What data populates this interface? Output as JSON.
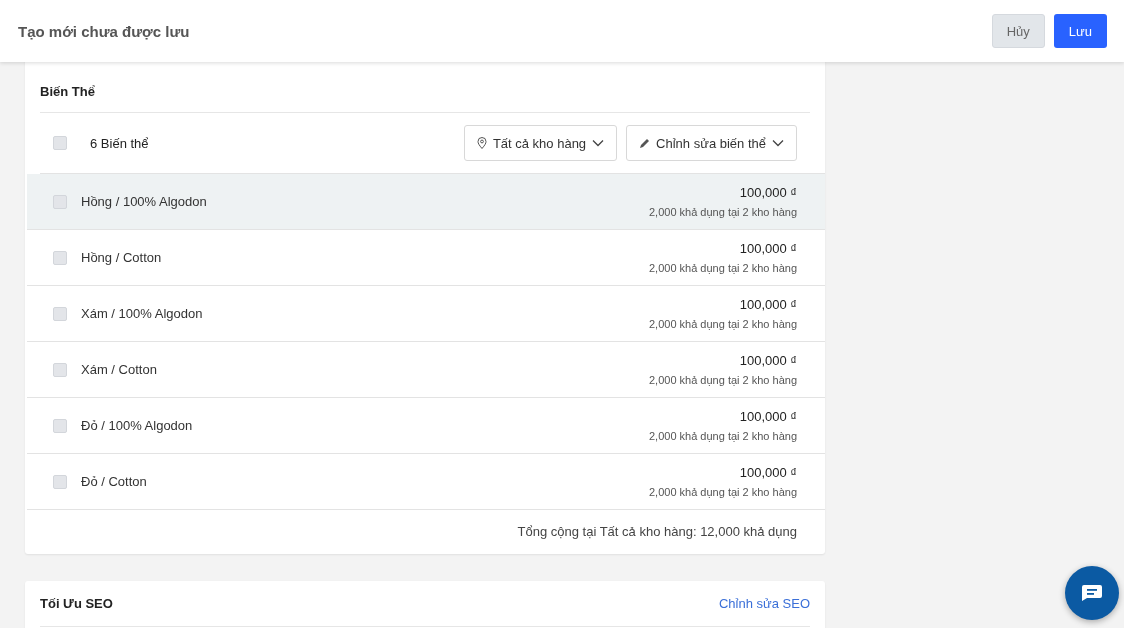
{
  "header": {
    "title": "Tạo mới chưa được lưu",
    "buttons": [
      {
        "label": "Hủy",
        "kind": "secondary"
      },
      {
        "label": "Lưu",
        "kind": "primary"
      }
    ]
  },
  "variants": {
    "title": "Biến Thể",
    "count_label": "6 Biến thể",
    "select_all_checked": false,
    "warehouse_filter": "Tất cả kho hàng",
    "edit_menu": "Chỉnh sửa biến thể",
    "rows": [
      {
        "name": "Hồng / 100% Algodon",
        "price": "100,000 ₫",
        "stock": "2,000 khả dụng tại 2 kho hàng",
        "checked": false,
        "hovered": true
      },
      {
        "name": "Hồng / Cotton",
        "price": "100,000 ₫",
        "stock": "2,000 khả dụng tại 2 kho hàng",
        "checked": false,
        "hovered": false
      },
      {
        "name": "Xám / 100% Algodon",
        "price": "100,000 ₫",
        "stock": "2,000 khả dụng tại 2 kho hàng",
        "checked": false,
        "hovered": false
      },
      {
        "name": "Xám / Cotton",
        "price": "100,000 ₫",
        "stock": "2,000 khả dụng tại 2 kho hàng",
        "checked": false,
        "hovered": false
      },
      {
        "name": "Đỏ / 100% Algodon",
        "price": "100,000 ₫",
        "stock": "2,000 khả dụng tại 2 kho hàng",
        "checked": false,
        "hovered": false
      },
      {
        "name": "Đỏ / Cotton",
        "price": "100,000 ₫",
        "stock": "2,000 khả dụng tại 2 kho hàng",
        "checked": false,
        "hovered": false
      }
    ],
    "total": "Tổng cộng tại Tất cả kho hàng: 12,000 khả dụng"
  },
  "seo": {
    "title": "Tối Ưu SEO",
    "edit_link": "Chỉnh sửa SEO"
  }
}
